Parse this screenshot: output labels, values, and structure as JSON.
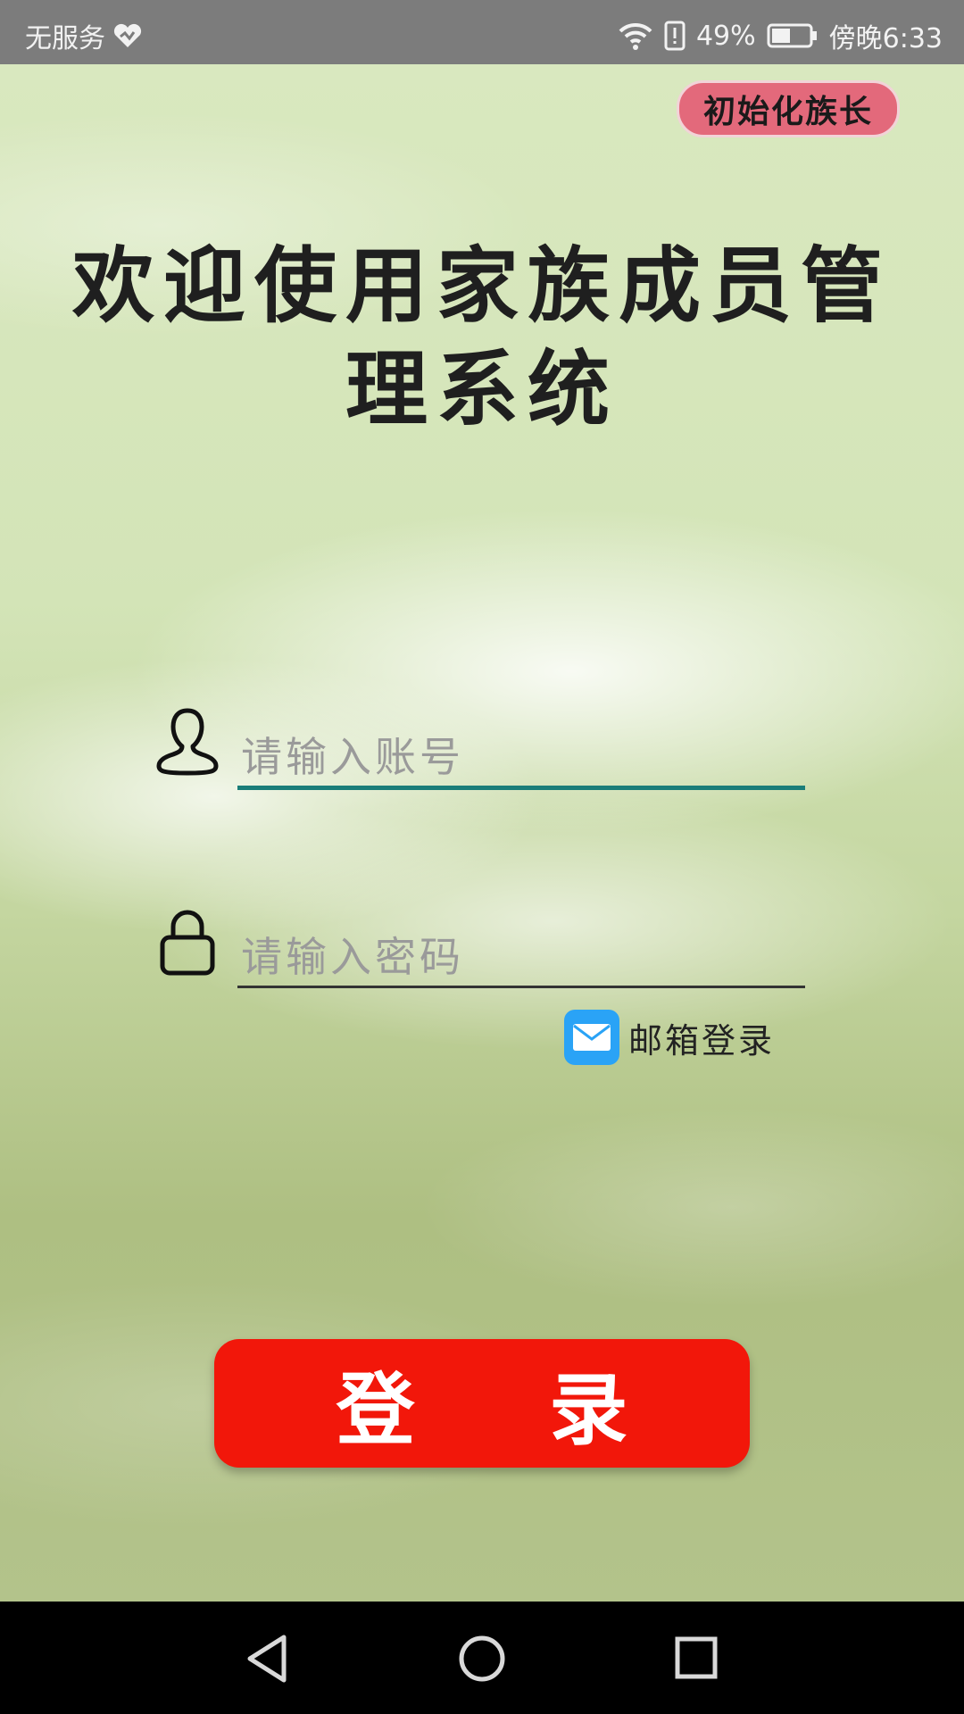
{
  "status_bar": {
    "carrier": "无服务",
    "battery_percent": "49%",
    "time": "傍晚6:33",
    "battery_level": 0.49
  },
  "app": {
    "init_button_label": "初始化族长",
    "title": "欢迎使用家族成员管理系统",
    "account_placeholder": "请输入账号",
    "password_placeholder": "请输入密码",
    "email_login_label": "邮箱登录",
    "login_button_label": "登 录"
  },
  "colors": {
    "accent_underline": "#1a7d79",
    "login_button": "#f2170a",
    "init_button": "#e3697b",
    "mail_icon": "#2aa3f6"
  },
  "icons": [
    "heart-signal-icon",
    "wifi-icon",
    "alert-sim-icon",
    "battery-icon",
    "user-icon",
    "lock-icon",
    "mail-icon",
    "back-icon",
    "home-icon",
    "recents-icon"
  ]
}
